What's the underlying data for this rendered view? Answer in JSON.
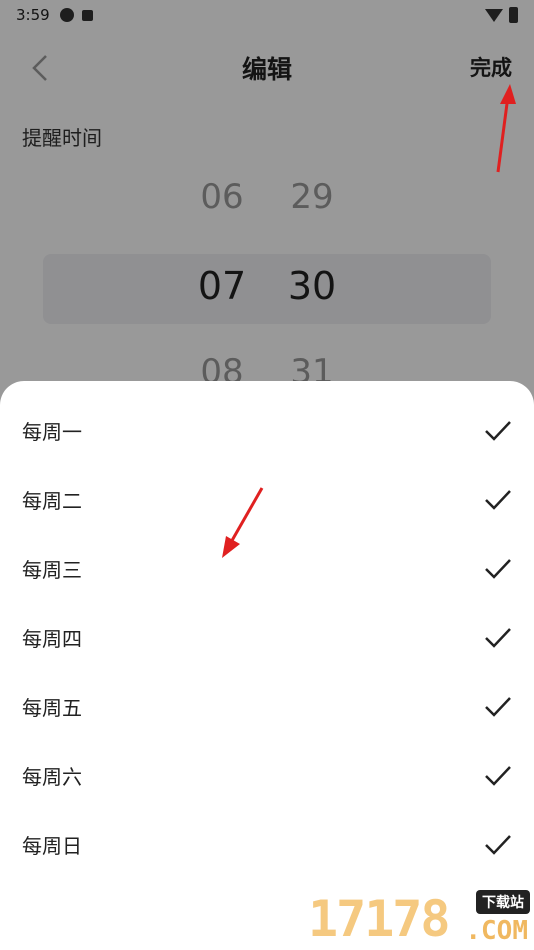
{
  "status_bar": {
    "time": "3:59"
  },
  "header": {
    "title": "编辑",
    "done_label": "完成"
  },
  "remind_label": "提醒时间",
  "time_picker": {
    "hours": [
      "06",
      "07",
      "08"
    ],
    "minutes": [
      "29",
      "30",
      "31"
    ],
    "selected_hour": "07",
    "selected_minute": "30"
  },
  "weekday_sheet": {
    "items": [
      {
        "label": "每周一",
        "checked": true
      },
      {
        "label": "每周二",
        "checked": true
      },
      {
        "label": "每周三",
        "checked": true
      },
      {
        "label": "每周四",
        "checked": true
      },
      {
        "label": "每周五",
        "checked": true
      },
      {
        "label": "每周六",
        "checked": true
      },
      {
        "label": "每周日",
        "checked": true
      }
    ]
  },
  "watermark": {
    "number": "17178",
    "badge": "下载站",
    "domain": ".COM"
  },
  "colors": {
    "annotation_arrow": "#e02020",
    "checkmark": "#222222"
  }
}
